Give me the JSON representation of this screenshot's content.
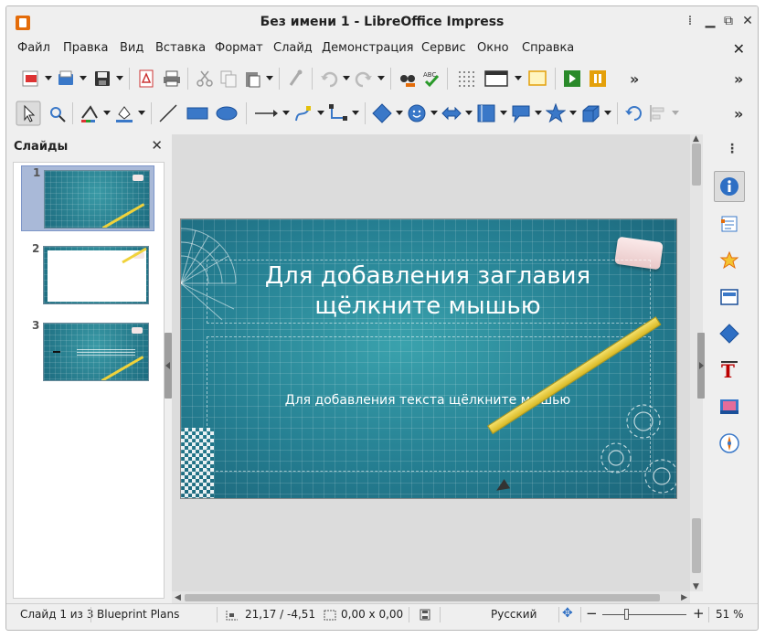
{
  "window": {
    "title": "Без имени 1 - LibreOffice Impress"
  },
  "menu": [
    "Файл",
    "Правка",
    "Вид",
    "Вставка",
    "Формат",
    "Слайд",
    "Демонстрация",
    "Сервис",
    "Окно",
    "Справка"
  ],
  "slide_pane": {
    "title": "Слайды",
    "slides": [
      {
        "number": "1",
        "selected": true
      },
      {
        "number": "2",
        "selected": false
      },
      {
        "number": "3",
        "selected": false
      }
    ]
  },
  "slide": {
    "title_placeholder": "Для добавления заглавия щёлкните мышью",
    "body_placeholder": "Для добавления текста щёлкните мышью"
  },
  "status": {
    "slide_counter": "Слайд 1 из 3",
    "master": "Blueprint Plans",
    "position": "21,17 / -4,51",
    "size": "0,00 x 0,00",
    "language": "Русский",
    "zoom": "51 %"
  },
  "colors": {
    "slide_bg": "#2a8797",
    "accent": "#e46c0a",
    "selection": "#a9b9d8"
  },
  "icons": {
    "toolbar1": [
      "templates-icon",
      "open-icon",
      "save-icon",
      "export-pdf-icon",
      "print-icon",
      "cut-icon",
      "copy-icon",
      "paste-icon",
      "clone-formatting-icon",
      "undo-icon",
      "redo-icon",
      "find-replace-icon",
      "spelling-icon",
      "grid-icon",
      "display-views-icon",
      "master-slide-icon",
      "start-first-icon",
      "start-current-icon"
    ],
    "toolbar2": [
      "select-icon",
      "zoom-pan-icon",
      "line-color-icon",
      "fill-color-icon",
      "line-icon",
      "rectangle-icon",
      "ellipse-icon",
      "arrow-line-icon",
      "curve-icon",
      "connector-icon",
      "basic-shapes-icon",
      "symbol-shapes-icon",
      "block-arrows-icon",
      "flowchart-icon",
      "callouts-icon",
      "stars-icon",
      "3d-objects-icon",
      "rotate-icon",
      "align-icon"
    ],
    "sidebar": [
      "properties-icon",
      "slide-transition-icon",
      "animation-icon",
      "master-slides-icon",
      "styles-icon",
      "fontwork-icon",
      "gallery-icon",
      "navigator-icon"
    ]
  }
}
